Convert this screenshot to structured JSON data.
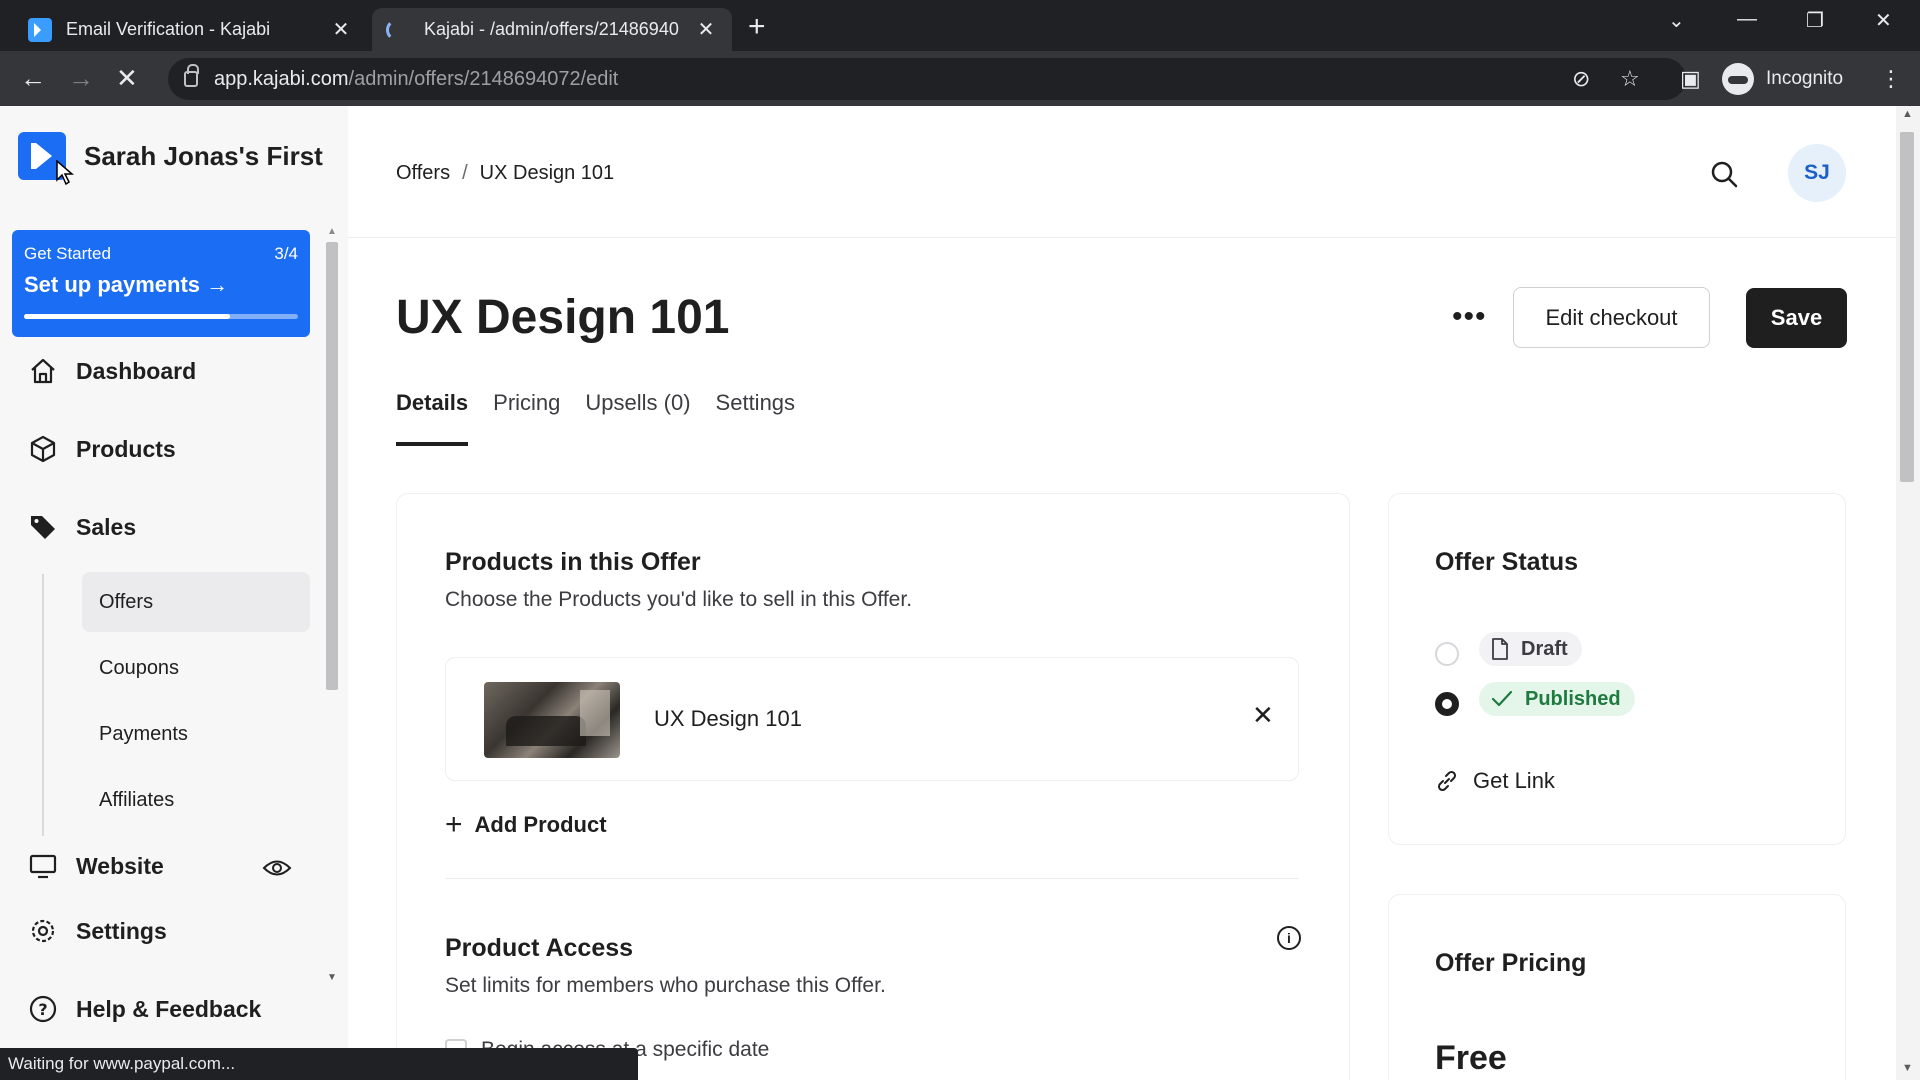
{
  "browser": {
    "tabs": [
      {
        "title": "Email Verification - Kajabi",
        "state": "inactive"
      },
      {
        "title": "Kajabi - /admin/offers/21486940",
        "state": "loading"
      }
    ],
    "url_host": "app.kajabi.com",
    "url_path": "/admin/offers/2148694072/edit",
    "profile_label": "Incognito",
    "status_text": "Waiting for www.paypal.com..."
  },
  "sidebar": {
    "site_name": "Sarah Jonas's First",
    "get_started": {
      "label": "Get Started",
      "progress_text": "3/4",
      "cta": "Set up payments",
      "progress_fraction": 0.75
    },
    "nav": {
      "dashboard": "Dashboard",
      "products": "Products",
      "sales": "Sales",
      "website": "Website",
      "settings": "Settings",
      "help": "Help & Feedback"
    },
    "sales_sub": {
      "offers": "Offers",
      "coupons": "Coupons",
      "payments": "Payments",
      "affiliates": "Affiliates"
    }
  },
  "header": {
    "breadcrumb_root": "Offers",
    "breadcrumb_sep": "/",
    "breadcrumb_current": "UX Design 101",
    "user_initials": "SJ"
  },
  "page": {
    "title": "UX Design 101",
    "more": "•••",
    "edit_checkout": "Edit checkout",
    "save": "Save",
    "tabs": {
      "details": "Details",
      "pricing": "Pricing",
      "upsells": "Upsells (0)",
      "settings": "Settings"
    }
  },
  "products_card": {
    "title": "Products in this Offer",
    "subtitle": "Choose the Products you'd like to sell in this Offer.",
    "product_name": "UX Design 101",
    "add_product": "Add Product",
    "access_title": "Product Access",
    "access_subtitle": "Set limits for members who purchase this Offer.",
    "begin_access": "Begin access at a specific date"
  },
  "status_card": {
    "title": "Offer Status",
    "draft": "Draft",
    "published": "Published",
    "get_link": "Get Link"
  },
  "pricing_card": {
    "title": "Offer Pricing",
    "price": "Free"
  },
  "colors": {
    "brand_blue": "#1b6ef3",
    "published_green": "#1f7a3f",
    "dark_button": "#1f1f1f"
  }
}
